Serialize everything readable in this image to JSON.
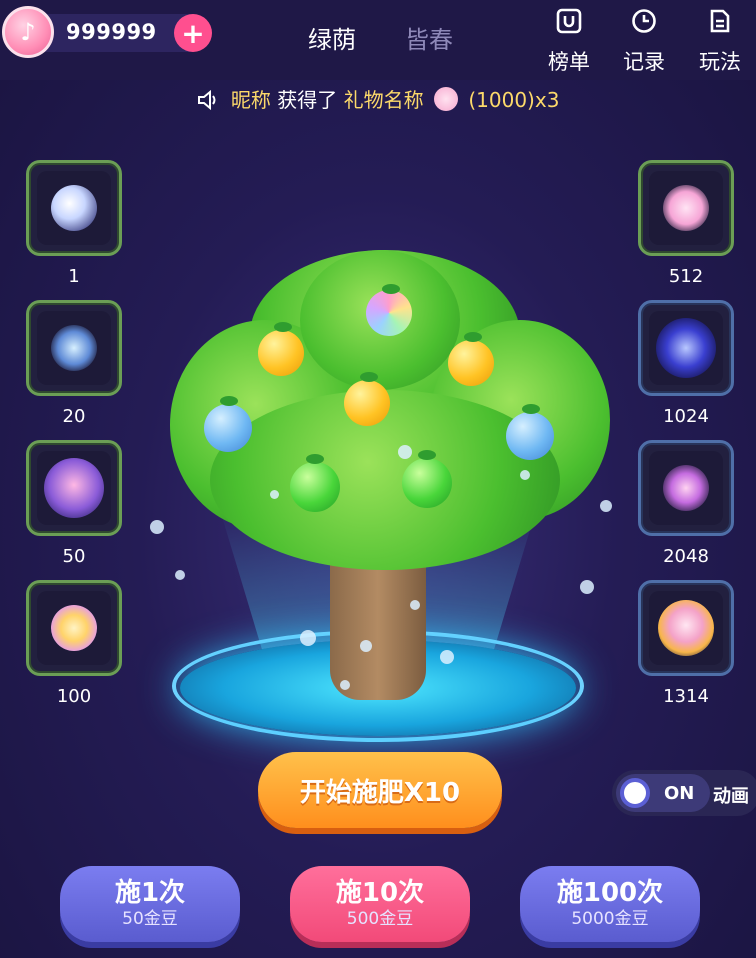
{
  "header": {
    "coin_balance": "999999",
    "add_label": "+",
    "tabs": [
      {
        "label": "绿荫",
        "active": true
      },
      {
        "label": "皆春",
        "active": false
      }
    ],
    "actions": [
      {
        "label": "榜单",
        "icon": "ranking-icon"
      },
      {
        "label": "记录",
        "icon": "clock-icon"
      },
      {
        "label": "玩法",
        "icon": "rules-doc-icon"
      }
    ]
  },
  "marquee": {
    "nickname": "昵称",
    "verb": "获得了",
    "gift_name": "礼物名称",
    "detail": "(1000)x3",
    "icon": "speaker-icon"
  },
  "left_slots": [
    {
      "value": "1",
      "border": "green",
      "gift": "moon-santa-gift"
    },
    {
      "value": "20",
      "border": "green",
      "gift": "crystal-fish-gift"
    },
    {
      "value": "50",
      "border": "green",
      "gift": "couple-badge-gift"
    },
    {
      "value": "100",
      "border": "green",
      "gift": "winged-crown-gift"
    }
  ],
  "right_slots": [
    {
      "value": "512",
      "border": "green",
      "gift": "bunny-doll-gift"
    },
    {
      "value": "1024",
      "border": "blue",
      "gift": "galaxy-orb-gift"
    },
    {
      "value": "2048",
      "border": "blue",
      "gift": "heart-butterfly-gift"
    },
    {
      "value": "1314",
      "border": "blue",
      "gift": "bunny-fireworks-gift"
    }
  ],
  "main": {
    "start_button": "开始施肥X10",
    "toggle": {
      "state": "ON",
      "label": "动画"
    }
  },
  "fertilize_buttons": [
    {
      "title": "施1次",
      "cost": "50金豆",
      "color": "purple"
    },
    {
      "title": "施10次",
      "cost": "500金豆",
      "color": "pink"
    },
    {
      "title": "施100次",
      "cost": "5000金豆",
      "color": "purple"
    }
  ],
  "colors": {
    "background": "#241c55",
    "accent_pink": "#ff4f8f",
    "accent_orange": "#ff9d2a",
    "accent_purple": "#6a6ce0",
    "gold_text": "#fcd96a"
  }
}
